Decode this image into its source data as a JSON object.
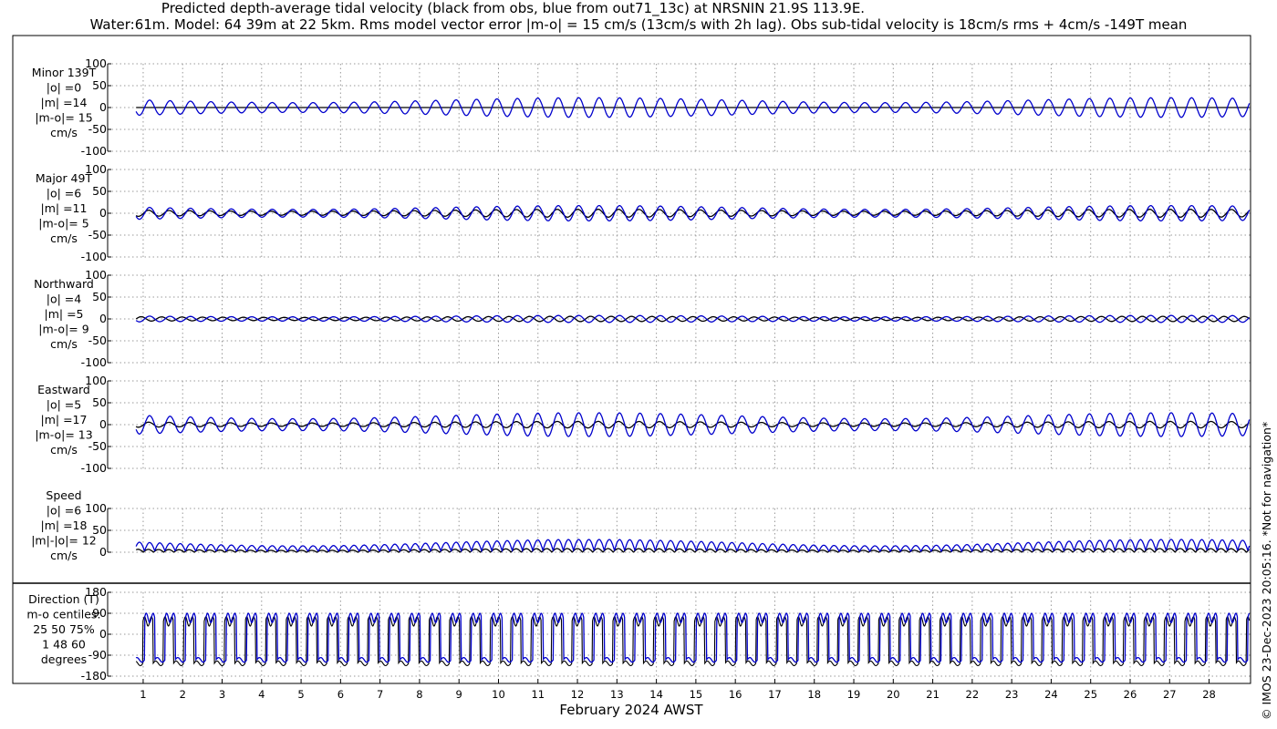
{
  "title_line1": "Predicted depth-average tidal velocity (black from obs, blue from out71_13c) at NRSNIN 21.9S 113.9E.",
  "title_line2": "Water:61m. Model: 64 39m at 22 5km. Rms model vector error |m-o| = 15 cm/s (13cm/s with 2h lag). Obs sub-tidal velocity is 18cm/s rms + 4cm/s -149T mean",
  "credit": "© IMOS 23-Dec-2023 20:05:16. *Not for navigation*",
  "colors": {
    "obs": "#000000",
    "model": "#0000cc",
    "grid": "#999999",
    "axis": "#000000"
  },
  "chart_data": [
    {
      "type": "line",
      "id": "minor",
      "label_lines": [
        "Minor 139T",
        "|o| =0",
        "|m| =14",
        "|m-o|= 15",
        "cm/s"
      ],
      "yticks": [
        "100",
        "50",
        "0",
        "-50",
        "-100"
      ],
      "ylim": [
        -100,
        100
      ],
      "grid": true,
      "model_amp": 14,
      "obs_amp": 0,
      "model_spring": 0.5
    },
    {
      "type": "line",
      "id": "major",
      "label_lines": [
        "Major 49T",
        "|o| =6",
        "|m| =11",
        "|m-o|= 5",
        "cm/s"
      ],
      "yticks": [
        "100",
        "50",
        "0",
        "-50",
        "-100"
      ],
      "ylim": [
        -100,
        100
      ],
      "grid": true,
      "model_amp": 11,
      "obs_amp": 6,
      "model_spring": 0.5
    },
    {
      "type": "line",
      "id": "north",
      "label_lines": [
        "Northward",
        "|o| =4",
        "|m| =5",
        "|m-o|= 9",
        "cm/s"
      ],
      "yticks": [
        "100",
        "50",
        "0",
        "-50",
        "-100"
      ],
      "ylim": [
        -100,
        100
      ],
      "grid": true,
      "model_amp": 5,
      "obs_amp": 4,
      "model_spring": 0.4
    },
    {
      "type": "line",
      "id": "east",
      "label_lines": [
        "Eastward",
        "|o| =5",
        "|m| =17",
        "|m-o|= 13",
        "cm/s"
      ],
      "yticks": [
        "100",
        "50",
        "0",
        "-50",
        "-100"
      ],
      "ylim": [
        -100,
        100
      ],
      "grid": true,
      "model_amp": 17,
      "obs_amp": 5,
      "model_spring": 0.5
    },
    {
      "type": "line",
      "id": "speed",
      "label_lines": [
        "Speed",
        "|o| =6",
        "|m| =18",
        "|m|-|o|= 12",
        "cm/s"
      ],
      "yticks": [
        "100",
        "50",
        "0"
      ],
      "ylim": [
        0,
        100
      ],
      "grid": true,
      "model_amp": 18,
      "obs_amp": 6,
      "model_spring": 0.5
    },
    {
      "type": "line",
      "id": "direction",
      "label_lines": [
        "Direction (T)",
        "m-o centiles:",
        "25  50  75%",
        "1  48  60",
        "degrees"
      ],
      "yticks": [
        "180",
        "90",
        "0",
        "-90",
        "-180"
      ],
      "ylim": [
        -180,
        180
      ],
      "grid": true
    }
  ],
  "x_axis": {
    "label": "February 2024 AWST",
    "ticks": [
      "1",
      "2",
      "3",
      "4",
      "5",
      "6",
      "7",
      "8",
      "9",
      "10",
      "11",
      "12",
      "13",
      "14",
      "15",
      "16",
      "17",
      "18",
      "19",
      "20",
      "21",
      "22",
      "23",
      "24",
      "25",
      "26",
      "27",
      "28"
    ],
    "xlim_days": [
      0.1,
      29.05
    ]
  }
}
